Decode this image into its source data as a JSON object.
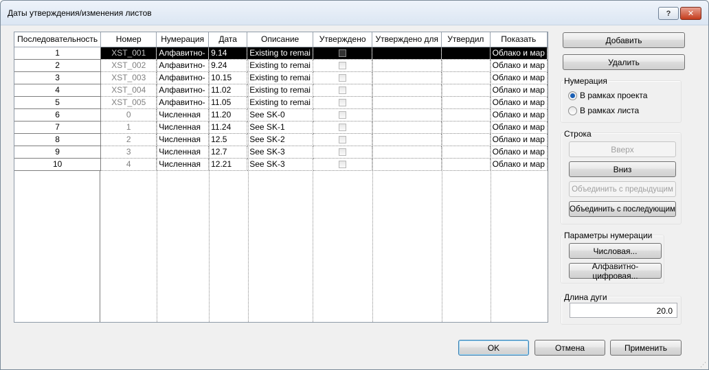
{
  "window": {
    "title": "Даты утверждения/изменения листов"
  },
  "titlebar": {
    "help_glyph": "?",
    "close_glyph": "✕"
  },
  "table": {
    "headers": [
      "Последовательность",
      "Номер",
      "Нумерация",
      "Дата",
      "Описание",
      "Утверждено",
      "Утверждено для",
      "Утвердил",
      "Показать"
    ],
    "rows": [
      {
        "seq": "1",
        "number": "XST_001",
        "numbering": "Алфавитно-",
        "date": "9.14",
        "description": "Existing to remai",
        "approved": false,
        "approved_for": "",
        "approved_by": "",
        "show": "Облако и мар",
        "selected": true
      },
      {
        "seq": "2",
        "number": "XST_002",
        "numbering": "Алфавитно-",
        "date": "9.24",
        "description": "Existing to remai",
        "approved": false,
        "approved_for": "",
        "approved_by": "",
        "show": "Облако и мар",
        "selected": false
      },
      {
        "seq": "3",
        "number": "XST_003",
        "numbering": "Алфавитно-",
        "date": "10.15",
        "description": "Existing to remai",
        "approved": false,
        "approved_for": "",
        "approved_by": "",
        "show": "Облако и мар",
        "selected": false
      },
      {
        "seq": "4",
        "number": "XST_004",
        "numbering": "Алфавитно-",
        "date": "11.02",
        "description": "Existing to remai",
        "approved": false,
        "approved_for": "",
        "approved_by": "",
        "show": "Облако и мар",
        "selected": false
      },
      {
        "seq": "5",
        "number": "XST_005",
        "numbering": "Алфавитно-",
        "date": "11.05",
        "description": "Existing to remai",
        "approved": false,
        "approved_for": "",
        "approved_by": "",
        "show": "Облако и мар",
        "selected": false
      },
      {
        "seq": "6",
        "number": "0",
        "numbering": "Численная",
        "date": "11.20",
        "description": "See SK-0",
        "approved": false,
        "approved_for": "",
        "approved_by": "",
        "show": "Облако и мар",
        "selected": false
      },
      {
        "seq": "7",
        "number": "1",
        "numbering": "Численная",
        "date": "11.24",
        "description": "See SK-1",
        "approved": false,
        "approved_for": "",
        "approved_by": "",
        "show": "Облако и мар",
        "selected": false
      },
      {
        "seq": "8",
        "number": "2",
        "numbering": "Численная",
        "date": "12.5",
        "description": "See SK-2",
        "approved": false,
        "approved_for": "",
        "approved_by": "",
        "show": "Облако и мар",
        "selected": false
      },
      {
        "seq": "9",
        "number": "3",
        "numbering": "Численная",
        "date": "12.7",
        "description": "See SK-3",
        "approved": false,
        "approved_for": "",
        "approved_by": "",
        "show": "Облако и мар",
        "selected": false
      },
      {
        "seq": "10",
        "number": "4",
        "numbering": "Численная",
        "date": "12.21",
        "description": "See SK-3",
        "approved": false,
        "approved_for": "",
        "approved_by": "",
        "show": "Облако и мар",
        "selected": false
      }
    ]
  },
  "side": {
    "add_label": "Добавить",
    "delete_label": "Удалить",
    "numbering_group": {
      "label": "Нумерация",
      "options": [
        "В рамках проекта",
        "В рамках листа"
      ],
      "selected": 0
    },
    "row_group": {
      "label": "Строка",
      "up_label": "Вверх",
      "down_label": "Вниз",
      "merge_prev_label": "Объединить с предыдущим",
      "merge_next_label": "Объединить с последующим"
    },
    "numbering_params": {
      "label": "Параметры нумерации",
      "numeric_label": "Числовая...",
      "alpha_label": "Алфавитно-цифровая..."
    },
    "arc_length": {
      "label": "Длина дуги",
      "value": "20.0"
    }
  },
  "footer": {
    "ok_label": "OK",
    "cancel_label": "Отмена",
    "apply_label": "Применить"
  }
}
